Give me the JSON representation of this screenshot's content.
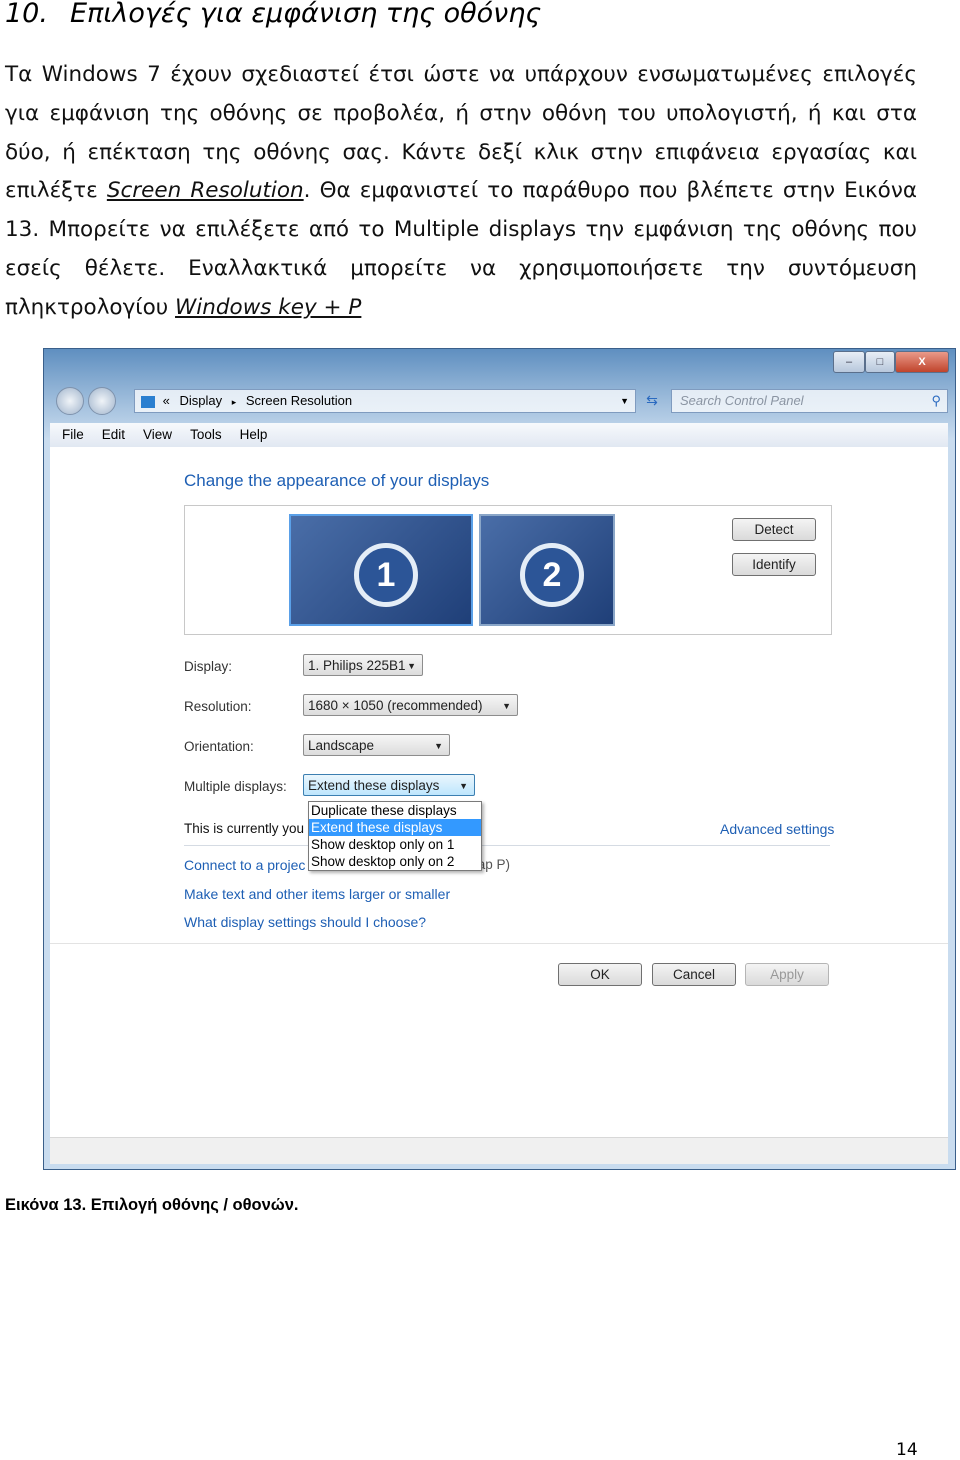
{
  "heading": {
    "number": "10.",
    "title": "Επιλογές για εμφάνιση της οθόνης"
  },
  "paragraph": {
    "part1": "Τα Windows 7 έχουν σχεδιαστεί έτσι ώστε να υπάρχουν ενσωματωμένες επιλογές για εμφάνιση της οθόνης σε προβολέα, ή στην οθόνη του υπολογιστή, ή και στα δύο, ή επέκταση της οθόνης σας. Κάντε δεξί κλικ στην επιφάνεια εργασίας και επιλέξτε ",
    "link1": "Screen Resolution",
    "part2": ". Θα εμφανιστεί το παράθυρο που βλέπετε στην Εικόνα 13. Μπορείτε να επιλέξετε από το Multiple displays την εμφάνιση της οθόνης που εσείς θέλετε. Εναλλακτικά μπορείτε να χρησιμοποιήσετε την συντόμευση πληκτρολογίου ",
    "link2": "Windows key + P"
  },
  "window": {
    "controls": {
      "minimize": "–",
      "maximize": "□",
      "close": "X"
    },
    "address": {
      "prefix": "«",
      "crumb1": "Display",
      "sep": "▸",
      "crumb2": "Screen Resolution"
    },
    "search_placeholder": "Search Control Panel",
    "menu": [
      "File",
      "Edit",
      "View",
      "Tools",
      "Help"
    ],
    "title": "Change the appearance of your displays",
    "monitors": [
      "1",
      "2"
    ],
    "detect": "Detect",
    "identify": "Identify",
    "display_label": "Display:",
    "display_value": "1. Philips 225B1",
    "resolution_label": "Resolution:",
    "resolution_value": "1680 × 1050 (recommended)",
    "orientation_label": "Orientation:",
    "orientation_value": "Landscape",
    "multiple_label": "Multiple displays:",
    "multiple_value": "Extend these displays",
    "dropdown_options": [
      "Duplicate these displays",
      "Extend these displays",
      "Show desktop only on 1",
      "Show desktop only on 2"
    ],
    "selected_option": 1,
    "current_text": "This is currently you",
    "advanced": "Advanced settings",
    "projector_link": "Connect to a projec",
    "projector_tail": "tap P)",
    "text_size_link": "Make text and other items larger or smaller",
    "help_link": "What display settings should I choose?",
    "ok": "OK",
    "cancel": "Cancel",
    "apply": "Apply",
    "link_color": "#1e5fb4",
    "selection_color": "#3399ff"
  },
  "caption": "Εικόνα 13. Επιλογή οθόνης / οθονών.",
  "page_number": "14"
}
